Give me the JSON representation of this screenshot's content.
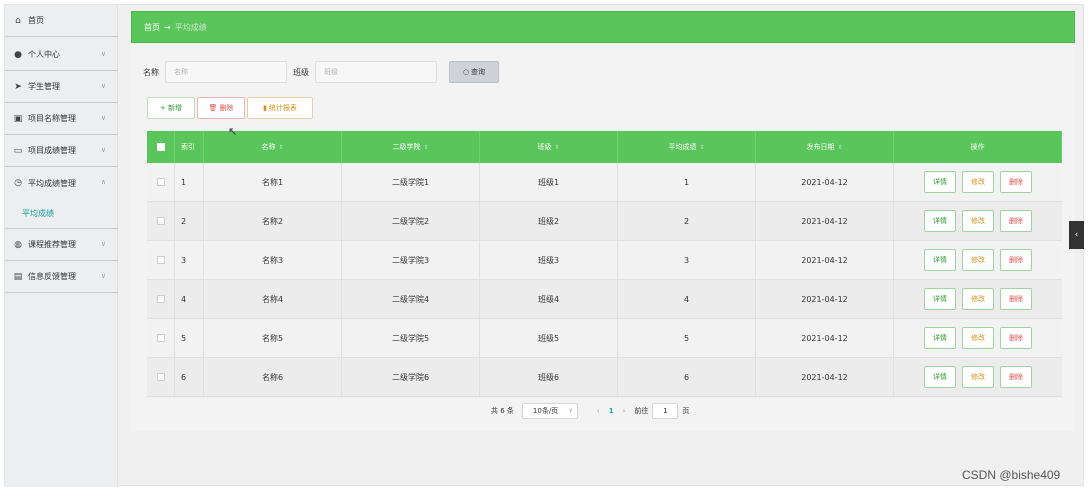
{
  "sidebar": {
    "items": [
      {
        "label": "首页",
        "icon": "home-icon"
      },
      {
        "label": "个人中心",
        "icon": "user-icon"
      },
      {
        "label": "学生管理",
        "icon": "send-icon"
      },
      {
        "label": "项目名称管理",
        "icon": "book-icon"
      },
      {
        "label": "项目成绩管理",
        "icon": "card-icon"
      },
      {
        "label": "平均成绩管理",
        "icon": "clock-icon"
      },
      {
        "label": "课程推荐管理",
        "icon": "globe-icon"
      },
      {
        "label": "信息反馈管理",
        "icon": "printer-icon"
      }
    ],
    "sub_item": "平均成绩"
  },
  "breadcrumb": {
    "home": "首页",
    "separator": "→",
    "current": "平均成绩"
  },
  "search": {
    "name_label": "名称",
    "name_placeholder": "名称",
    "class_label": "班级",
    "class_placeholder": "班级",
    "query_label": "查询"
  },
  "actions": {
    "add": "+ 新增",
    "delete": "删除",
    "stats": "统计报表"
  },
  "table": {
    "headers": [
      "索引",
      "名称",
      "二级学院",
      "班级",
      "平均成绩",
      "发布日期",
      "操作"
    ],
    "rows": [
      {
        "index": "1",
        "name": "名称1",
        "college": "二级学院1",
        "class": "班级1",
        "score": "1",
        "date": "2021-04-12"
      },
      {
        "index": "2",
        "name": "名称2",
        "college": "二级学院2",
        "class": "班级2",
        "score": "2",
        "date": "2021-04-12"
      },
      {
        "index": "3",
        "name": "名称3",
        "college": "二级学院3",
        "class": "班级3",
        "score": "3",
        "date": "2021-04-12"
      },
      {
        "index": "4",
        "name": "名称4",
        "college": "二级学院4",
        "class": "班级4",
        "score": "4",
        "date": "2021-04-12"
      },
      {
        "index": "5",
        "name": "名称5",
        "college": "二级学院5",
        "class": "班级5",
        "score": "5",
        "date": "2021-04-12"
      },
      {
        "index": "6",
        "name": "名称6",
        "college": "二级学院6",
        "class": "班级6",
        "score": "6",
        "date": "2021-04-12"
      }
    ],
    "op_detail": "详情",
    "op_edit": "修改",
    "op_delete": "删除"
  },
  "pager": {
    "total": "共 6 条",
    "page_size": "10条/页",
    "current_page": "1",
    "goto": "前往",
    "goto_value": "1",
    "page_unit": "页"
  },
  "watermark": "CSDN @bishe409",
  "colors": {
    "accent": "#5ac55a",
    "link": "#2aa2a2"
  }
}
